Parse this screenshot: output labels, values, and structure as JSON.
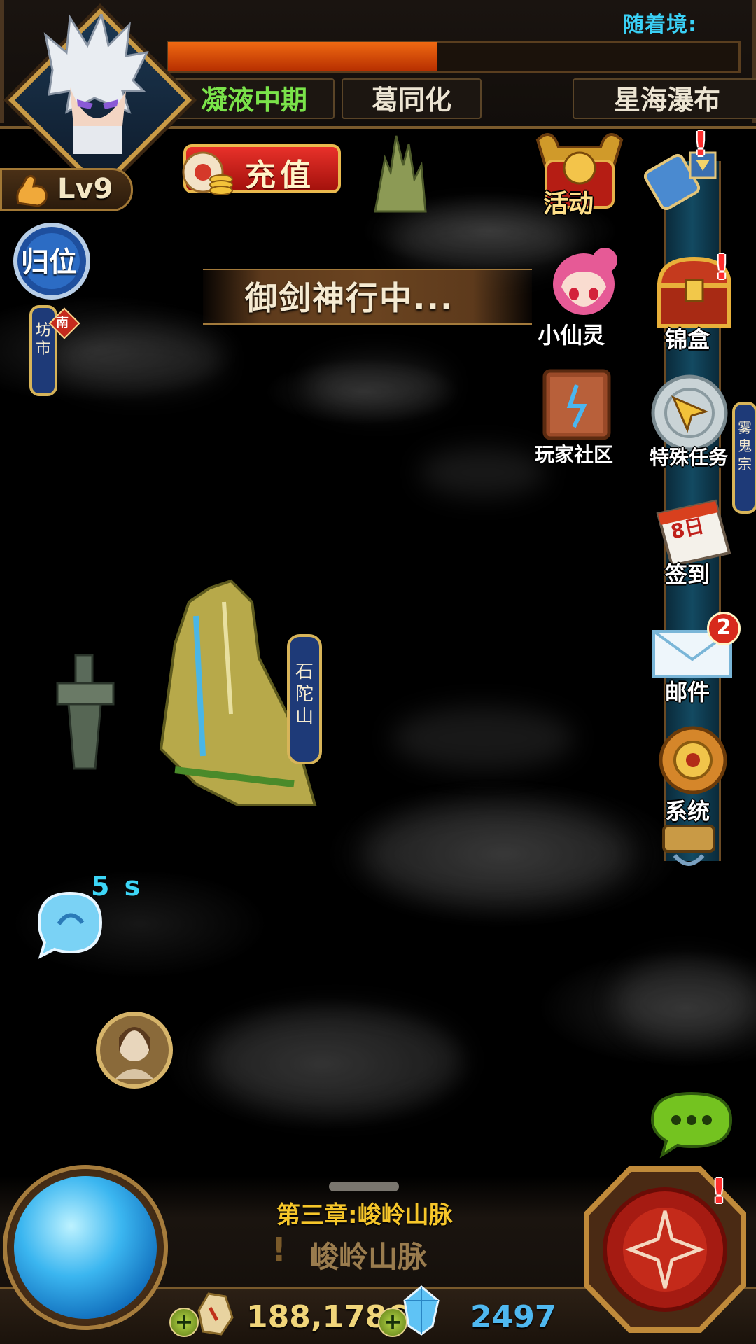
{
  "header": {
    "realm_label": "随着境:",
    "exp_progress": 0.47,
    "realm_stage": "凝液中期",
    "character_name": "葛同化",
    "map_name": "星海瀑布",
    "level": "Lv9"
  },
  "recharge": {
    "label": "充值"
  },
  "left_menu": {
    "return_label": "归位",
    "market_label": "坊市",
    "market_badge": "南"
  },
  "status": {
    "travel_text": "御剑神行中...",
    "timer": "5 s"
  },
  "right_menu": {
    "activity": "活动",
    "fairy": "小仙灵",
    "chest": "锦盒",
    "community": "玩家社区",
    "special_task": "特殊任务",
    "sign_in": "签到",
    "sign_in_day": "8日",
    "mail": "邮件",
    "mail_count": "2",
    "system": "系统",
    "sect_tag": "雾鬼宗"
  },
  "map": {
    "location_tag": "石陀山"
  },
  "bottom": {
    "chapter_title": "第三章:峻岭山脉",
    "chapter_subtitle": "峻岭山脉",
    "gold": "188,1786",
    "gems": "2497"
  },
  "colors": {
    "exp_bar": "#f06a12",
    "realm_stage_text": "#7ae34a",
    "realm_label_text": "#3ad0f5",
    "chapter_title_text": "#f6c62a",
    "gem_text": "#4fb8f0"
  }
}
